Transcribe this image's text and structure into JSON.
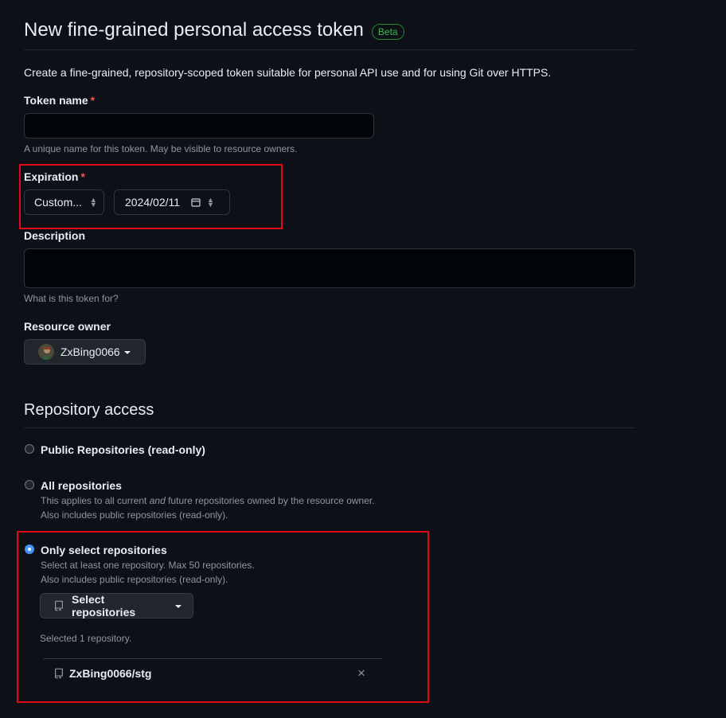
{
  "header": {
    "title": "New fine-grained personal access token",
    "badge": "Beta"
  },
  "intro_text": "Create a fine-grained, repository-scoped token suitable for personal API use and for using Git over HTTPS.",
  "token_name": {
    "label": "Token name",
    "required_mark": "*",
    "value": "",
    "note": "A unique name for this token. May be visible to resource owners."
  },
  "expiration": {
    "label": "Expiration",
    "required_mark": "*",
    "select_value": "Custom...",
    "date_value": "2024/02/11"
  },
  "description": {
    "label": "Description",
    "value": "",
    "note": "What is this token for?"
  },
  "resource_owner": {
    "label": "Resource owner",
    "value": "ZxBing0066"
  },
  "repository_access": {
    "title": "Repository access",
    "options": [
      {
        "label": "Public Repositories (read-only)",
        "selected": false
      },
      {
        "label": "All repositories",
        "desc_before": "This applies to all current ",
        "desc_em": "and",
        "desc_after": " future repositories owned by the resource owner.",
        "desc2": "Also includes public repositories (read-only).",
        "selected": false
      },
      {
        "label": "Only select repositories",
        "desc1": "Select at least one repository. Max 50 repositories.",
        "desc2": "Also includes public repositories (read-only).",
        "selected": true
      }
    ],
    "select_button": "Select repositories",
    "selected_count": "Selected 1 repository.",
    "selected_repos": [
      "ZxBing0066/stg"
    ],
    "remove_glyph": "×"
  },
  "colors": {
    "background": "#0d1117",
    "accent_blue": "#4493f8",
    "beta_green": "#3fb950",
    "required_red": "#f85149",
    "highlight_red": "#e00a18"
  },
  "icons": {
    "calendar": "calendar-icon",
    "repo": "repo-icon",
    "close": "close-icon",
    "avatar": "avatar"
  }
}
